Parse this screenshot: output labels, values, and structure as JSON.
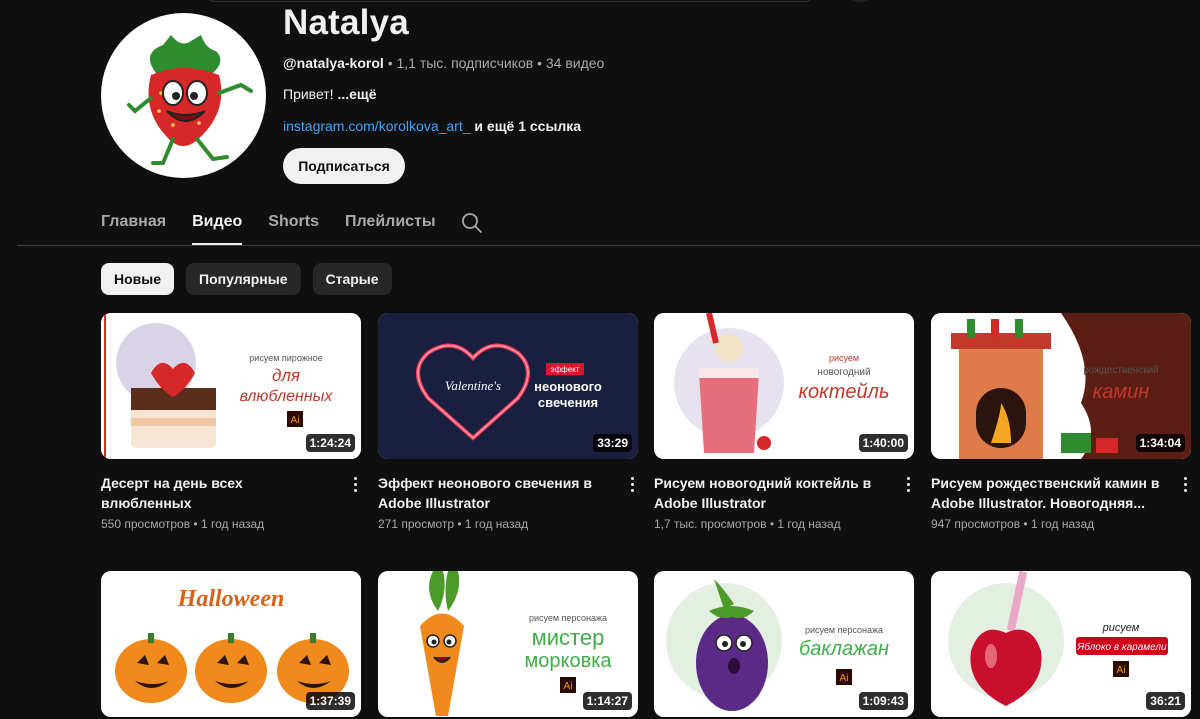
{
  "channel": {
    "name": "Natalya",
    "handle": "@natalya-korol",
    "subscribers": "1,1 тыс. подписчиков",
    "videos_count": "34 видео",
    "description": "Привет!",
    "more": "...ещё",
    "link": "instagram.com/korolkova_art_",
    "extra_links": "и ещё 1 ссылка",
    "subscribe_label": "Подписаться"
  },
  "tabs": [
    "Главная",
    "Видео",
    "Shorts",
    "Плейлисты"
  ],
  "active_tab": "Видео",
  "chips": [
    "Новые",
    "Популярные",
    "Старые"
  ],
  "active_chip": "Новые",
  "videos": [
    {
      "title": "Десерт на день всех влюбленных",
      "views": "550 просмотров",
      "age": "1 год назад",
      "duration": "1:24:24",
      "thumb_text": [
        "рисуем пирожное",
        "для",
        "влюбленных"
      ],
      "accent": "#c0392b"
    },
    {
      "title": "Эффект неонового свечения в Adobe Illustrator",
      "views": "271 просмотр",
      "age": "1 год назад",
      "duration": "33:29",
      "thumb_text": [
        "эффект",
        "неонового",
        "свечения"
      ],
      "accent": "#ff3b5c"
    },
    {
      "title": "Рисуем новогодний коктейль в Adobe Illustrator",
      "views": "1,7 тыс. просмотров",
      "age": "1 год назад",
      "duration": "1:40:00",
      "thumb_text": [
        "рисуем",
        "новогодний",
        "коктейль"
      ],
      "accent": "#c0392b"
    },
    {
      "title": "Рисуем рождественский камин в Adobe Illustrator. Новогодняя...",
      "views": "947 просмотров",
      "age": "1 год назад",
      "duration": "1:34:04",
      "thumb_text": [
        "рождественский",
        "камин"
      ],
      "accent": "#c0392b"
    },
    {
      "title": "",
      "views": "",
      "age": "",
      "duration": "1:37:39",
      "thumb_text": [
        "Halloween"
      ],
      "accent": "#e67e22"
    },
    {
      "title": "",
      "views": "",
      "age": "",
      "duration": "1:14:27",
      "thumb_text": [
        "рисуем персонажа",
        "мистер",
        "морковка"
      ],
      "accent": "#3fae49"
    },
    {
      "title": "",
      "views": "",
      "age": "",
      "duration": "1:09:43",
      "thumb_text": [
        "рисуем персонажа",
        "баклажан"
      ],
      "accent": "#3fae49"
    },
    {
      "title": "",
      "views": "",
      "age": "",
      "duration": "36:21",
      "thumb_text": [
        "рисуем",
        "Яблоко в карамели"
      ],
      "accent": "#d0021b"
    }
  ],
  "colors": {
    "background": "#0f0f0f",
    "link": "#3ea6ff",
    "text_secondary": "#aaaaaa"
  },
  "icons": {
    "search": "search-icon",
    "menu": "more-vert-icon"
  }
}
